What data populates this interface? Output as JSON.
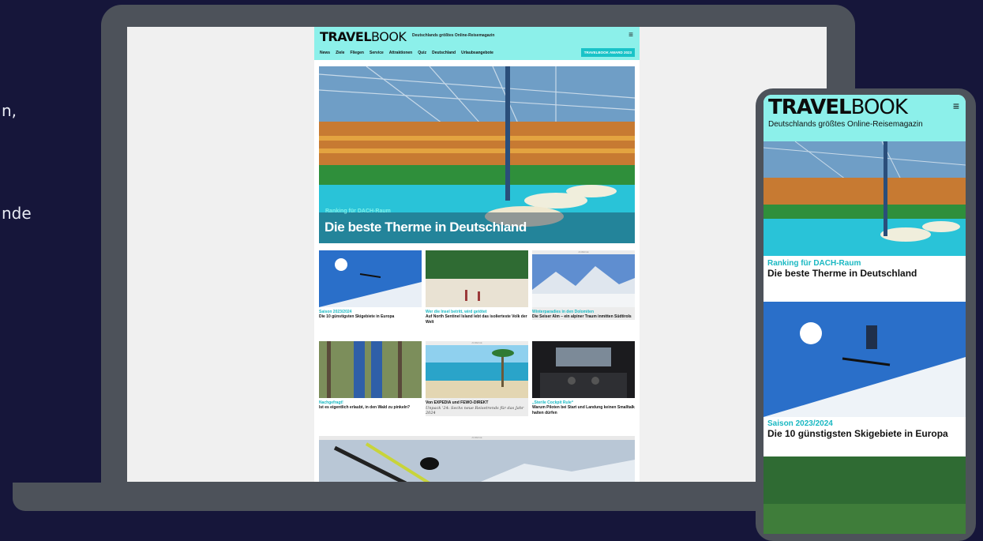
{
  "left_text": {
    "line1": "n,",
    "line2": "nde"
  },
  "site": {
    "logo_bold": "TRAVEL",
    "logo_light": "BOOK",
    "tagline": "Deutschlands größtes Online-Reisemagazin",
    "nav": [
      "News",
      "Ziele",
      "Fliegen",
      "Service",
      "Attraktionen",
      "Quiz",
      "Deutschland",
      "Urlaubsangebote"
    ],
    "award": "TRAVELBOOK AWARD 2023",
    "hero": {
      "kicker": "Ranking für DACH-Raum",
      "title": "Die beste Therme in Deutschland"
    },
    "cards": [
      {
        "kicker": "Saison 2023/2024",
        "title": "Die 10 günstigsten Skigebiete in Europa"
      },
      {
        "kicker": "Wer die Insel betritt, wird getötet",
        "title": "Auf North Sentinel Island lebt das isolierteste Volk der Welt"
      },
      {
        "ad": "ANZEIGE",
        "kicker": "Winterparadies in den Dolomiten",
        "title": "Die Seiser Alm – ein alpiner Traum inmitten Südtirols"
      },
      {
        "kicker": "Nachgefragt!",
        "title": "Ist es eigentlich erlaubt, in den Wald zu pinkeln?"
      },
      {
        "ad": "ANZEIGE",
        "kicker": "Von EXPEDIA und FEWO-DIREKT",
        "title": "Unpack '24: Sechs neue Reisetrends für das Jahr 2024"
      },
      {
        "kicker": "„Sterile Cockpit Rule“",
        "title": "Warum Piloten bei Start und Landung keinen Smalltalk halten dürfen"
      }
    ],
    "big_ad": "ANZEIGE"
  },
  "mobile": {
    "logo_bold": "TRAVEL",
    "logo_light": "BOOK",
    "tagline": "Deutschlands größtes Online-Reisemagazin",
    "item1": {
      "kicker": "Ranking für DACH-Raum",
      "title": "Die beste Therme in Deutschland"
    },
    "item2": {
      "kicker": "Saison 2023/2024",
      "title": "Die 10 günstigsten Skigebiete in Europa"
    }
  }
}
